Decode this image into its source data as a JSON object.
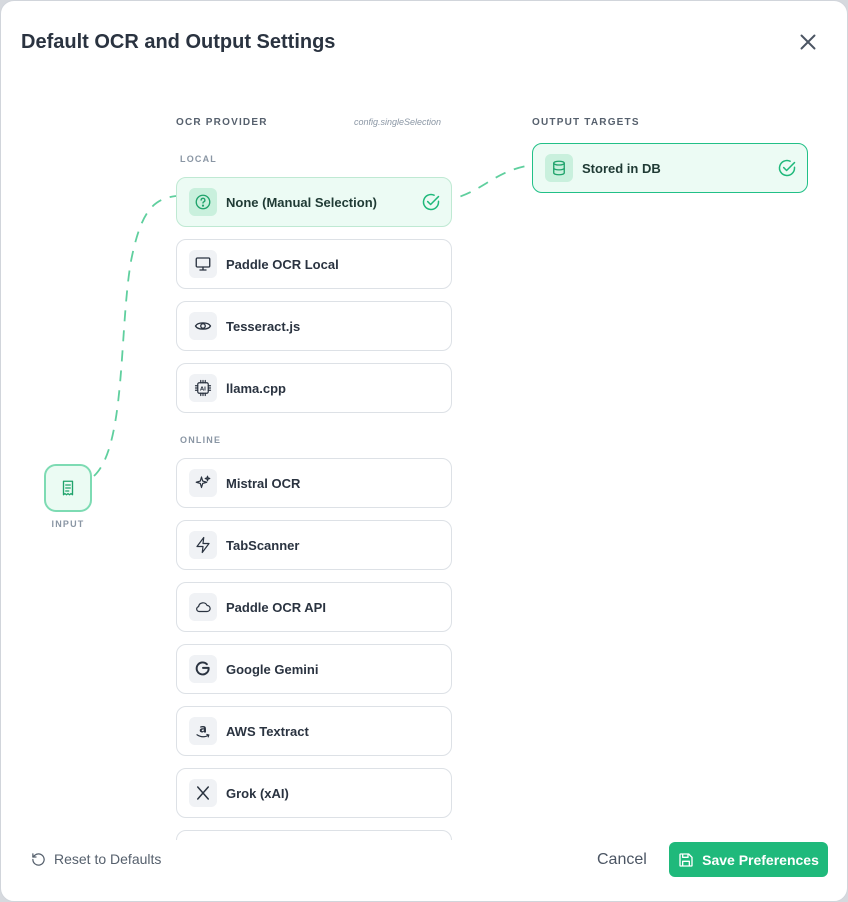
{
  "modal": {
    "title": "Default OCR and Output Settings",
    "close_icon": "x-icon"
  },
  "input_node": {
    "label": "INPUT",
    "icon": "receipt-icon"
  },
  "ocr": {
    "heading": "OCR PROVIDER",
    "config_key": "config.singleSelection",
    "local_label": "LOCAL",
    "online_label": "ONLINE",
    "local": [
      {
        "label": "None (Manual Selection)",
        "icon": "help-circle-icon",
        "selected": true
      },
      {
        "label": "Paddle OCR Local",
        "icon": "monitor-icon",
        "selected": false
      },
      {
        "label": "Tesseract.js",
        "icon": "eye-icon",
        "selected": false
      },
      {
        "label": "llama.cpp",
        "icon": "ai-chip-icon",
        "selected": false
      }
    ],
    "online": [
      {
        "label": "Mistral OCR",
        "icon": "sparkles-icon",
        "selected": false
      },
      {
        "label": "TabScanner",
        "icon": "zap-icon",
        "selected": false
      },
      {
        "label": "Paddle OCR API",
        "icon": "cloud-icon",
        "selected": false
      },
      {
        "label": "Google Gemini",
        "icon": "google-icon",
        "selected": false
      },
      {
        "label": "AWS Textract",
        "icon": "amazon-icon",
        "selected": false
      },
      {
        "label": "Grok (xAI)",
        "icon": "x-logo-icon",
        "selected": false
      }
    ]
  },
  "output": {
    "heading": "OUTPUT TARGETS",
    "targets": [
      {
        "label": "Stored in DB",
        "icon": "database-icon",
        "selected": true
      }
    ]
  },
  "footer": {
    "reset_label": "Reset to Defaults",
    "cancel_label": "Cancel",
    "save_label": "Save Preferences"
  },
  "colors": {
    "accent": "#1fb97b",
    "selected_bg": "#ecfbf4",
    "selected_border": "#21c087"
  }
}
